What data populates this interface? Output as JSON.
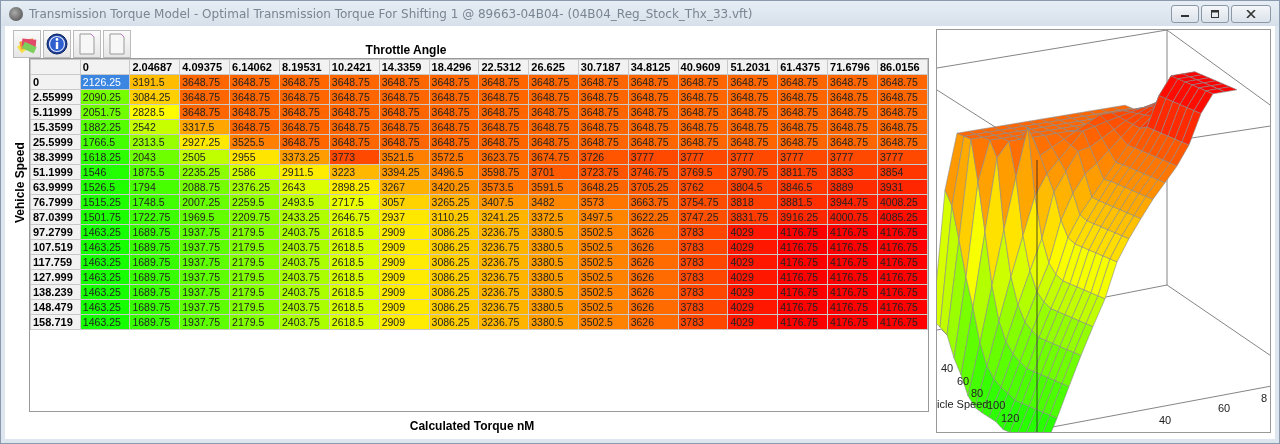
{
  "window": {
    "title": "Transmission Torque Model - Optimal Transmission Torque For Shifting 1 @ 89663-04B04- (04B04_Reg_Stock_Thx_33.vft)"
  },
  "table": {
    "x_axis_title": "Throttle Angle",
    "y_axis_title": "Vehicle Speed",
    "value_title": "Calculated Torque nM",
    "columns": [
      "0",
      "2.04687",
      "4.09375",
      "6.14062",
      "8.19531",
      "10.2421",
      "14.3359",
      "18.4296",
      "22.5312",
      "26.625",
      "30.7187",
      "34.8125",
      "40.9609",
      "51.2031",
      "61.4375",
      "71.6796",
      "86.0156"
    ],
    "rows": [
      {
        "label": "0",
        "cells": [
          {
            "value": "2126.25",
            "selected": true
          },
          {
            "value": "3191.5",
            "selected": false
          },
          {
            "value": "3648.75",
            "selected": false
          },
          {
            "value": "3648.75",
            "selected": false
          },
          {
            "value": "3648.75",
            "selected": false
          },
          {
            "value": "3648.75",
            "selected": false
          },
          {
            "value": "3648.75",
            "selected": false
          },
          {
            "value": "3648.75",
            "selected": false
          },
          {
            "value": "3648.75",
            "selected": false
          },
          {
            "value": "3648.75",
            "selected": false
          },
          {
            "value": "3648.75",
            "selected": false
          },
          {
            "value": "3648.75",
            "selected": false
          },
          {
            "value": "3648.75",
            "selected": false
          },
          {
            "value": "3648.75",
            "selected": false
          },
          {
            "value": "3648.75",
            "selected": false
          },
          {
            "value": "3648.75",
            "selected": false
          },
          {
            "value": "3648.75",
            "selected": false
          }
        ]
      },
      {
        "label": "2.55999",
        "cells": [
          {
            "value": "2090.25",
            "selected": false
          },
          {
            "value": "3084.25",
            "selected": false
          },
          {
            "value": "3648.75",
            "selected": false
          },
          {
            "value": "3648.75",
            "selected": false
          },
          {
            "value": "3648.75",
            "selected": false
          },
          {
            "value": "3648.75",
            "selected": false
          },
          {
            "value": "3648.75",
            "selected": false
          },
          {
            "value": "3648.75",
            "selected": false
          },
          {
            "value": "3648.75",
            "selected": false
          },
          {
            "value": "3648.75",
            "selected": false
          },
          {
            "value": "3648.75",
            "selected": false
          },
          {
            "value": "3648.75",
            "selected": false
          },
          {
            "value": "3648.75",
            "selected": false
          },
          {
            "value": "3648.75",
            "selected": false
          },
          {
            "value": "3648.75",
            "selected": false
          },
          {
            "value": "3648.75",
            "selected": false
          },
          {
            "value": "3648.75",
            "selected": false
          }
        ]
      },
      {
        "label": "5.11999",
        "cells": [
          {
            "value": "2051.75",
            "selected": false
          },
          {
            "value": "2828.5",
            "selected": false
          },
          {
            "value": "3648.75",
            "selected": false
          },
          {
            "value": "3648.75",
            "selected": false
          },
          {
            "value": "3648.75",
            "selected": false
          },
          {
            "value": "3648.75",
            "selected": false
          },
          {
            "value": "3648.75",
            "selected": false
          },
          {
            "value": "3648.75",
            "selected": false
          },
          {
            "value": "3648.75",
            "selected": false
          },
          {
            "value": "3648.75",
            "selected": false
          },
          {
            "value": "3648.75",
            "selected": false
          },
          {
            "value": "3648.75",
            "selected": false
          },
          {
            "value": "3648.75",
            "selected": false
          },
          {
            "value": "3648.75",
            "selected": false
          },
          {
            "value": "3648.75",
            "selected": false
          },
          {
            "value": "3648.75",
            "selected": false
          },
          {
            "value": "3648.75",
            "selected": false
          }
        ]
      },
      {
        "label": "15.3599",
        "cells": [
          {
            "value": "1882.25",
            "selected": false
          },
          {
            "value": "2542",
            "selected": false
          },
          {
            "value": "3317.5",
            "selected": false
          },
          {
            "value": "3648.75",
            "selected": false
          },
          {
            "value": "3648.75",
            "selected": false
          },
          {
            "value": "3648.75",
            "selected": false
          },
          {
            "value": "3648.75",
            "selected": false
          },
          {
            "value": "3648.75",
            "selected": false
          },
          {
            "value": "3648.75",
            "selected": false
          },
          {
            "value": "3648.75",
            "selected": false
          },
          {
            "value": "3648.75",
            "selected": false
          },
          {
            "value": "3648.75",
            "selected": false
          },
          {
            "value": "3648.75",
            "selected": false
          },
          {
            "value": "3648.75",
            "selected": false
          },
          {
            "value": "3648.75",
            "selected": false
          },
          {
            "value": "3648.75",
            "selected": false
          },
          {
            "value": "3648.75",
            "selected": false
          }
        ]
      },
      {
        "label": "25.5999",
        "cells": [
          {
            "value": "1766.5",
            "selected": false
          },
          {
            "value": "2313.5",
            "selected": false
          },
          {
            "value": "2927.25",
            "selected": false
          },
          {
            "value": "3525.5",
            "selected": false
          },
          {
            "value": "3648.75",
            "selected": false
          },
          {
            "value": "3648.75",
            "selected": false
          },
          {
            "value": "3648.75",
            "selected": false
          },
          {
            "value": "3648.75",
            "selected": false
          },
          {
            "value": "3648.75",
            "selected": false
          },
          {
            "value": "3648.75",
            "selected": false
          },
          {
            "value": "3648.75",
            "selected": false
          },
          {
            "value": "3648.75",
            "selected": false
          },
          {
            "value": "3648.75",
            "selected": false
          },
          {
            "value": "3648.75",
            "selected": false
          },
          {
            "value": "3648.75",
            "selected": false
          },
          {
            "value": "3648.75",
            "selected": false
          },
          {
            "value": "3648.75",
            "selected": false
          }
        ]
      },
      {
        "label": "38.3999",
        "cells": [
          {
            "value": "1618.25",
            "selected": false
          },
          {
            "value": "2043",
            "selected": false
          },
          {
            "value": "2505",
            "selected": false
          },
          {
            "value": "2955",
            "selected": false
          },
          {
            "value": "3373.25",
            "selected": false
          },
          {
            "value": "3773",
            "selected": false
          },
          {
            "value": "3521.5",
            "selected": false
          },
          {
            "value": "3572.5",
            "selected": false
          },
          {
            "value": "3623.75",
            "selected": false
          },
          {
            "value": "3674.75",
            "selected": false
          },
          {
            "value": "3726",
            "selected": false
          },
          {
            "value": "3777",
            "selected": false
          },
          {
            "value": "3777",
            "selected": false
          },
          {
            "value": "3777",
            "selected": false
          },
          {
            "value": "3777",
            "selected": false
          },
          {
            "value": "3777",
            "selected": false
          },
          {
            "value": "3777",
            "selected": false
          }
        ]
      },
      {
        "label": "51.1999",
        "cells": [
          {
            "value": "1546",
            "selected": false
          },
          {
            "value": "1875.5",
            "selected": false
          },
          {
            "value": "2235.25",
            "selected": false
          },
          {
            "value": "2586",
            "selected": false
          },
          {
            "value": "2911.5",
            "selected": false
          },
          {
            "value": "3223",
            "selected": false
          },
          {
            "value": "3394.25",
            "selected": false
          },
          {
            "value": "3496.5",
            "selected": false
          },
          {
            "value": "3598.75",
            "selected": false
          },
          {
            "value": "3701",
            "selected": false
          },
          {
            "value": "3723.75",
            "selected": false
          },
          {
            "value": "3746.75",
            "selected": false
          },
          {
            "value": "3769.5",
            "selected": false
          },
          {
            "value": "3790.75",
            "selected": false
          },
          {
            "value": "3811.75",
            "selected": false
          },
          {
            "value": "3833",
            "selected": false
          },
          {
            "value": "3854",
            "selected": false
          }
        ]
      },
      {
        "label": "63.9999",
        "cells": [
          {
            "value": "1526.5",
            "selected": false
          },
          {
            "value": "1794",
            "selected": false
          },
          {
            "value": "2088.75",
            "selected": false
          },
          {
            "value": "2376.25",
            "selected": false
          },
          {
            "value": "2643",
            "selected": false
          },
          {
            "value": "2898.25",
            "selected": false
          },
          {
            "value": "3267",
            "selected": false
          },
          {
            "value": "3420.25",
            "selected": false
          },
          {
            "value": "3573.5",
            "selected": false
          },
          {
            "value": "3591.5",
            "selected": false
          },
          {
            "value": "3648.25",
            "selected": false
          },
          {
            "value": "3705.25",
            "selected": false
          },
          {
            "value": "3762",
            "selected": false
          },
          {
            "value": "3804.5",
            "selected": false
          },
          {
            "value": "3846.5",
            "selected": false
          },
          {
            "value": "3889",
            "selected": false
          },
          {
            "value": "3931",
            "selected": false
          }
        ]
      },
      {
        "label": "76.7999",
        "cells": [
          {
            "value": "1515.25",
            "selected": false
          },
          {
            "value": "1748.5",
            "selected": false
          },
          {
            "value": "2007.25",
            "selected": false
          },
          {
            "value": "2259.5",
            "selected": false
          },
          {
            "value": "2493.5",
            "selected": false
          },
          {
            "value": "2717.5",
            "selected": false
          },
          {
            "value": "3057",
            "selected": false
          },
          {
            "value": "3265.25",
            "selected": false
          },
          {
            "value": "3407.5",
            "selected": false
          },
          {
            "value": "3482",
            "selected": false
          },
          {
            "value": "3573",
            "selected": false
          },
          {
            "value": "3663.75",
            "selected": false
          },
          {
            "value": "3754.75",
            "selected": false
          },
          {
            "value": "3818",
            "selected": false
          },
          {
            "value": "3881.5",
            "selected": false
          },
          {
            "value": "3944.75",
            "selected": false
          },
          {
            "value": "4008.25",
            "selected": false
          }
        ]
      },
      {
        "label": "87.0399",
        "cells": [
          {
            "value": "1501.75",
            "selected": false
          },
          {
            "value": "1722.75",
            "selected": false
          },
          {
            "value": "1969.5",
            "selected": false
          },
          {
            "value": "2209.75",
            "selected": false
          },
          {
            "value": "2433.25",
            "selected": false
          },
          {
            "value": "2646.75",
            "selected": false
          },
          {
            "value": "2937",
            "selected": false
          },
          {
            "value": "3110.25",
            "selected": false
          },
          {
            "value": "3241.25",
            "selected": false
          },
          {
            "value": "3372.5",
            "selected": false
          },
          {
            "value": "3497.5",
            "selected": false
          },
          {
            "value": "3622.25",
            "selected": false
          },
          {
            "value": "3747.25",
            "selected": false
          },
          {
            "value": "3831.75",
            "selected": false
          },
          {
            "value": "3916.25",
            "selected": false
          },
          {
            "value": "4000.75",
            "selected": false
          },
          {
            "value": "4085.25",
            "selected": false
          }
        ]
      },
      {
        "label": "97.2799",
        "cells": [
          {
            "value": "1463.25",
            "selected": false
          },
          {
            "value": "1689.75",
            "selected": false
          },
          {
            "value": "1937.75",
            "selected": false
          },
          {
            "value": "2179.5",
            "selected": false
          },
          {
            "value": "2403.75",
            "selected": false
          },
          {
            "value": "2618.5",
            "selected": false
          },
          {
            "value": "2909",
            "selected": false
          },
          {
            "value": "3086.25",
            "selected": false
          },
          {
            "value": "3236.75",
            "selected": false
          },
          {
            "value": "3380.5",
            "selected": false
          },
          {
            "value": "3502.5",
            "selected": false
          },
          {
            "value": "3626",
            "selected": false
          },
          {
            "value": "3783",
            "selected": false
          },
          {
            "value": "4029",
            "selected": false
          },
          {
            "value": "4176.75",
            "selected": false
          },
          {
            "value": "4176.75",
            "selected": false
          },
          {
            "value": "4176.75",
            "selected": false
          }
        ]
      },
      {
        "label": "107.519",
        "cells": [
          {
            "value": "1463.25",
            "selected": false
          },
          {
            "value": "1689.75",
            "selected": false
          },
          {
            "value": "1937.75",
            "selected": false
          },
          {
            "value": "2179.5",
            "selected": false
          },
          {
            "value": "2403.75",
            "selected": false
          },
          {
            "value": "2618.5",
            "selected": false
          },
          {
            "value": "2909",
            "selected": false
          },
          {
            "value": "3086.25",
            "selected": false
          },
          {
            "value": "3236.75",
            "selected": false
          },
          {
            "value": "3380.5",
            "selected": false
          },
          {
            "value": "3502.5",
            "selected": false
          },
          {
            "value": "3626",
            "selected": false
          },
          {
            "value": "3783",
            "selected": false
          },
          {
            "value": "4029",
            "selected": false
          },
          {
            "value": "4176.75",
            "selected": false
          },
          {
            "value": "4176.75",
            "selected": false
          },
          {
            "value": "4176.75",
            "selected": false
          }
        ]
      },
      {
        "label": "117.759",
        "cells": [
          {
            "value": "1463.25",
            "selected": false
          },
          {
            "value": "1689.75",
            "selected": false
          },
          {
            "value": "1937.75",
            "selected": false
          },
          {
            "value": "2179.5",
            "selected": false
          },
          {
            "value": "2403.75",
            "selected": false
          },
          {
            "value": "2618.5",
            "selected": false
          },
          {
            "value": "2909",
            "selected": false
          },
          {
            "value": "3086.25",
            "selected": false
          },
          {
            "value": "3236.75",
            "selected": false
          },
          {
            "value": "3380.5",
            "selected": false
          },
          {
            "value": "3502.5",
            "selected": false
          },
          {
            "value": "3626",
            "selected": false
          },
          {
            "value": "3783",
            "selected": false
          },
          {
            "value": "4029",
            "selected": false
          },
          {
            "value": "4176.75",
            "selected": false
          },
          {
            "value": "4176.75",
            "selected": false
          },
          {
            "value": "4176.75",
            "selected": false
          }
        ]
      },
      {
        "label": "127.999",
        "cells": [
          {
            "value": "1463.25",
            "selected": false
          },
          {
            "value": "1689.75",
            "selected": false
          },
          {
            "value": "1937.75",
            "selected": false
          },
          {
            "value": "2179.5",
            "selected": false
          },
          {
            "value": "2403.75",
            "selected": false
          },
          {
            "value": "2618.5",
            "selected": false
          },
          {
            "value": "2909",
            "selected": false
          },
          {
            "value": "3086.25",
            "selected": false
          },
          {
            "value": "3236.75",
            "selected": false
          },
          {
            "value": "3380.5",
            "selected": false
          },
          {
            "value": "3502.5",
            "selected": false
          },
          {
            "value": "3626",
            "selected": false
          },
          {
            "value": "3783",
            "selected": false
          },
          {
            "value": "4029",
            "selected": false
          },
          {
            "value": "4176.75",
            "selected": false
          },
          {
            "value": "4176.75",
            "selected": false
          },
          {
            "value": "4176.75",
            "selected": false
          }
        ]
      },
      {
        "label": "138.239",
        "cells": [
          {
            "value": "1463.25",
            "selected": false
          },
          {
            "value": "1689.75",
            "selected": false
          },
          {
            "value": "1937.75",
            "selected": false
          },
          {
            "value": "2179.5",
            "selected": false
          },
          {
            "value": "2403.75",
            "selected": false
          },
          {
            "value": "2618.5",
            "selected": false
          },
          {
            "value": "2909",
            "selected": false
          },
          {
            "value": "3086.25",
            "selected": false
          },
          {
            "value": "3236.75",
            "selected": false
          },
          {
            "value": "3380.5",
            "selected": false
          },
          {
            "value": "3502.5",
            "selected": false
          },
          {
            "value": "3626",
            "selected": false
          },
          {
            "value": "3783",
            "selected": false
          },
          {
            "value": "4029",
            "selected": false
          },
          {
            "value": "4176.75",
            "selected": false
          },
          {
            "value": "4176.75",
            "selected": false
          },
          {
            "value": "4176.75",
            "selected": false
          }
        ]
      },
      {
        "label": "148.479",
        "cells": [
          {
            "value": "1463.25",
            "selected": false
          },
          {
            "value": "1689.75",
            "selected": false
          },
          {
            "value": "1937.75",
            "selected": false
          },
          {
            "value": "2179.5",
            "selected": false
          },
          {
            "value": "2403.75",
            "selected": false
          },
          {
            "value": "2618.5",
            "selected": false
          },
          {
            "value": "2909",
            "selected": false
          },
          {
            "value": "3086.25",
            "selected": false
          },
          {
            "value": "3236.75",
            "selected": false
          },
          {
            "value": "3380.5",
            "selected": false
          },
          {
            "value": "3502.5",
            "selected": false
          },
          {
            "value": "3626",
            "selected": false
          },
          {
            "value": "3783",
            "selected": false
          },
          {
            "value": "4029",
            "selected": false
          },
          {
            "value": "4176.75",
            "selected": false
          },
          {
            "value": "4176.75",
            "selected": false
          },
          {
            "value": "4176.75",
            "selected": false
          }
        ]
      },
      {
        "label": "158.719",
        "cells": [
          {
            "value": "1463.25",
            "selected": false
          },
          {
            "value": "1689.75",
            "selected": false
          },
          {
            "value": "1937.75",
            "selected": false
          },
          {
            "value": "2179.5",
            "selected": false
          },
          {
            "value": "2403.75",
            "selected": false
          },
          {
            "value": "2618.5",
            "selected": false
          },
          {
            "value": "2909",
            "selected": false
          },
          {
            "value": "3086.25",
            "selected": false
          },
          {
            "value": "3236.75",
            "selected": false
          },
          {
            "value": "3380.5",
            "selected": false
          },
          {
            "value": "3502.5",
            "selected": false
          },
          {
            "value": "3626",
            "selected": false
          },
          {
            "value": "3783",
            "selected": false
          },
          {
            "value": "4029",
            "selected": false
          },
          {
            "value": "4176.75",
            "selected": false
          },
          {
            "value": "4176.75",
            "selected": false
          },
          {
            "value": "4176.75",
            "selected": false
          }
        ]
      }
    ]
  },
  "plot_3d": {
    "speed_axis_label": "icle Speed",
    "speed_ticks": [
      "40",
      "60",
      "80",
      "100",
      "120"
    ],
    "throttle_ticks": [
      "40",
      "60",
      "8"
    ]
  }
}
